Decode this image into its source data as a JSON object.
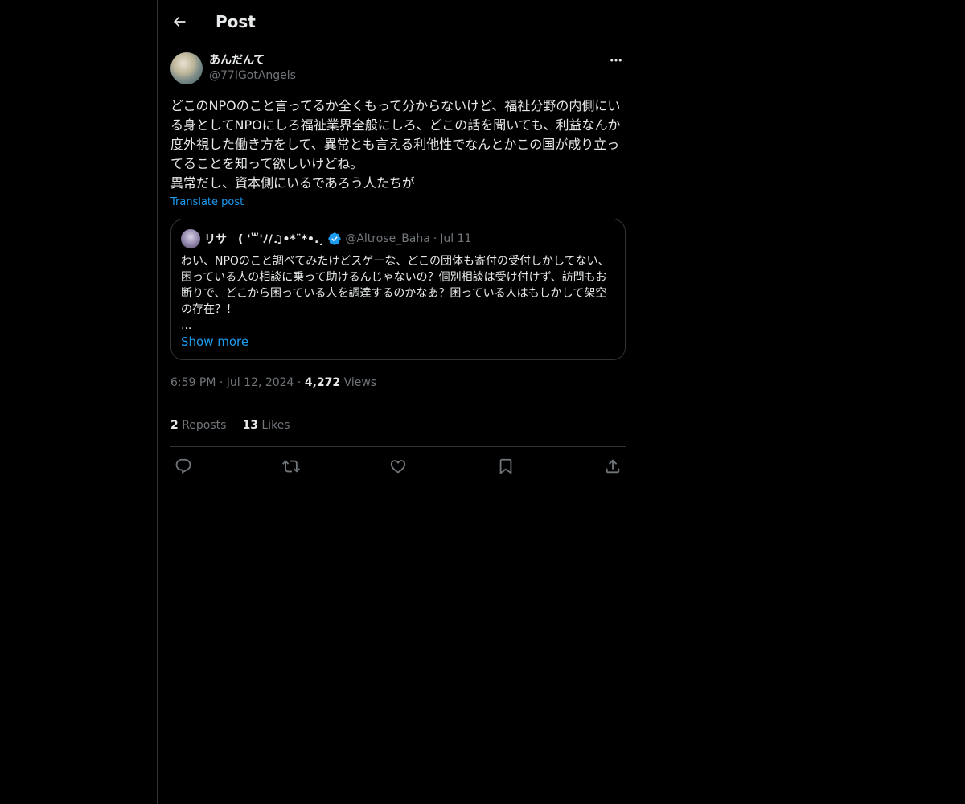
{
  "header": {
    "title": "Post",
    "back_icon": "arrow-left-icon"
  },
  "post": {
    "author": {
      "display_name": "あんだんて",
      "handle": "@77IGotAngels"
    },
    "body": "どこのNPOのこと言ってるか全くもって分からないけど、福祉分野の内側にいる身としてNPOにしろ福祉業界全般にしろ、どこの話を聞いても、利益なんか度外視した働き方をして、異常とも言える利他性でなんとかこの国が成り立ってることを知って欲しいけどね。\n異常だし、資本側にいるであろう人たちが",
    "translate_label": "Translate post",
    "quote": {
      "display_name": "リサ　( '꒳'ﾉ/♫•*¨*•.¸",
      "handle": "@Altrose_Baha",
      "separator": "·",
      "date": "Jul 11",
      "body": "わい、NPOのこと調べてみたけどスゲーな、どこの団体も寄付の受付しかしてない、困っている人の相談に乗って助けるんじゃないの？個別相談は受け付けず、訪問もお断りで、どこから困っている人を調達するのかなあ？困っている人はもしかして架空の存在？！",
      "ellipsis": "...",
      "show_more": "Show more"
    },
    "meta": {
      "time": "6:59 PM",
      "dot1": "·",
      "date": "Jul 12, 2024",
      "dot2": "·",
      "views_count": "4,272",
      "views_label": "Views"
    },
    "stats": {
      "reposts_count": "2",
      "reposts_label": "Reposts",
      "likes_count": "13",
      "likes_label": "Likes"
    }
  },
  "colors": {
    "background": "#000000",
    "text": "#e7e9ea",
    "muted": "#71767b",
    "accent": "#1d9bf0",
    "border": "#2f3336"
  }
}
